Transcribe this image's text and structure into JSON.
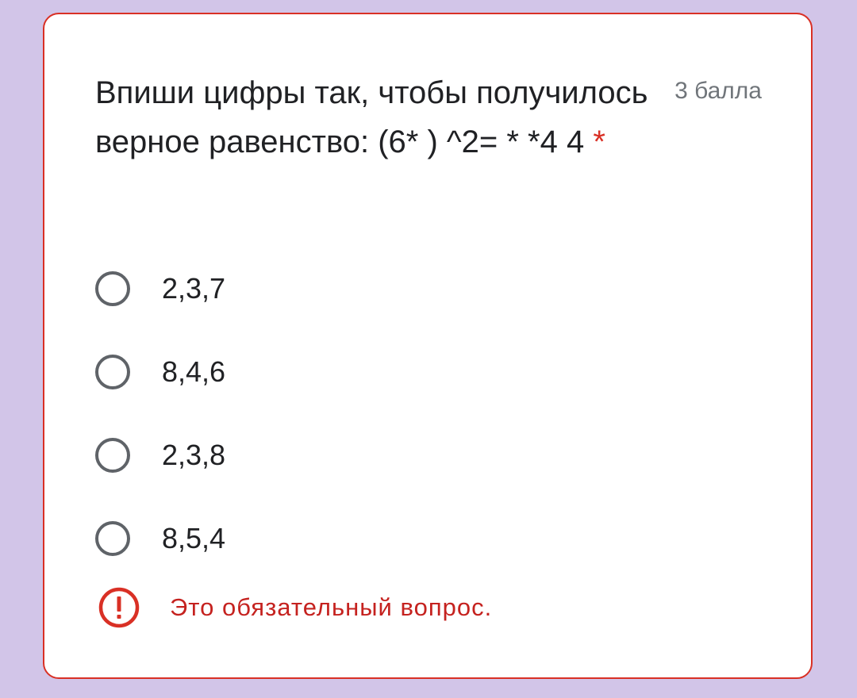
{
  "question": {
    "title": "Впиши цифры так, чтобы получилось верное равенство: (6* ) ^2= * *4 4",
    "required_marker": "*",
    "points": "3 балла"
  },
  "options": [
    {
      "label": "2,3,7",
      "selected": false
    },
    {
      "label": "8,4,6",
      "selected": false
    },
    {
      "label": "2,3,8",
      "selected": false
    },
    {
      "label": "8,5,4",
      "selected": false
    }
  ],
  "error": {
    "icon": "error-icon",
    "text": "Это обязательный вопрос."
  },
  "colors": {
    "page_background": "#d2c5e8",
    "card_border": "#d93025",
    "error_text": "#c5221f",
    "radio_border": "#5f6368"
  }
}
